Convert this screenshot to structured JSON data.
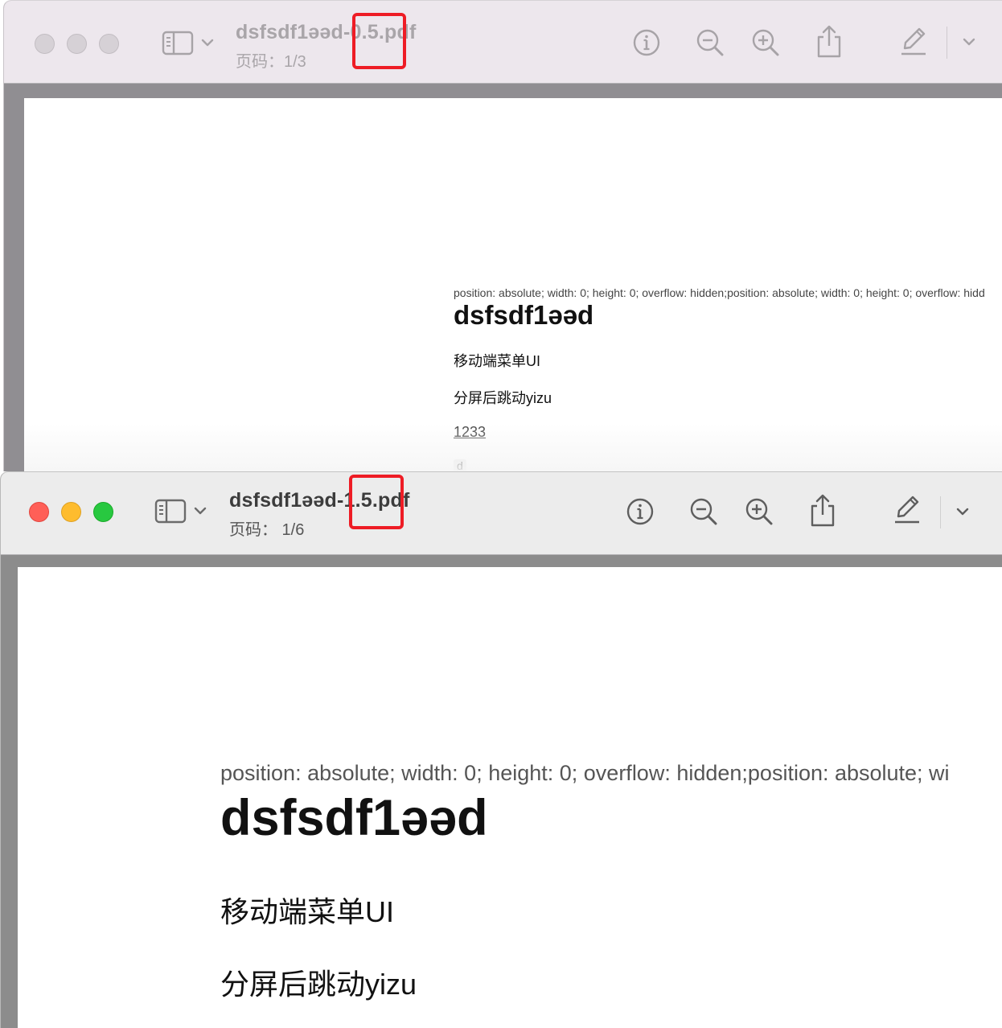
{
  "windows": [
    {
      "id": "back",
      "title_prefix": "dsfsdf1əəd",
      "title_dash": "-",
      "title_version": "0.5.",
      "title_suffix": "pdf",
      "page_indicator": "页码：1/3",
      "content": {
        "css_line": "position: absolute; width: 0; height: 0; overflow: hidden;position: absolute; width: 0; height: 0; overflow: hidd",
        "heading": "dsfsdf1əəd",
        "line1": "移动端菜单UI",
        "line2": "分屏后跳动yizu",
        "link": "1233",
        "partial": "d"
      }
    },
    {
      "id": "front",
      "title_prefix": "dsfsdf1əəd",
      "title_dash": "-",
      "title_version": "1.5.",
      "title_suffix": "pdf",
      "page_indicator": "页码： 1/6",
      "content": {
        "css_line": "position: absolute; width: 0; height: 0; overflow: hidden;position: absolute; wi",
        "heading": "dsfsdf1əəd",
        "line1": "移动端菜单UI",
        "line2": "分屏后跳动yizu"
      }
    }
  ],
  "icons": {
    "sidebar": "sidebar-toggle-icon",
    "info": "info-icon",
    "zoom_out": "zoom-out-icon",
    "zoom_in": "zoom-in-icon",
    "share": "share-icon",
    "markup": "markup-pen-icon",
    "more": "chevron-down-icon"
  },
  "colors": {
    "highlight": "#ee1c25",
    "close": "#ff5f57",
    "minimize": "#febc2e",
    "zoom": "#28c840"
  }
}
